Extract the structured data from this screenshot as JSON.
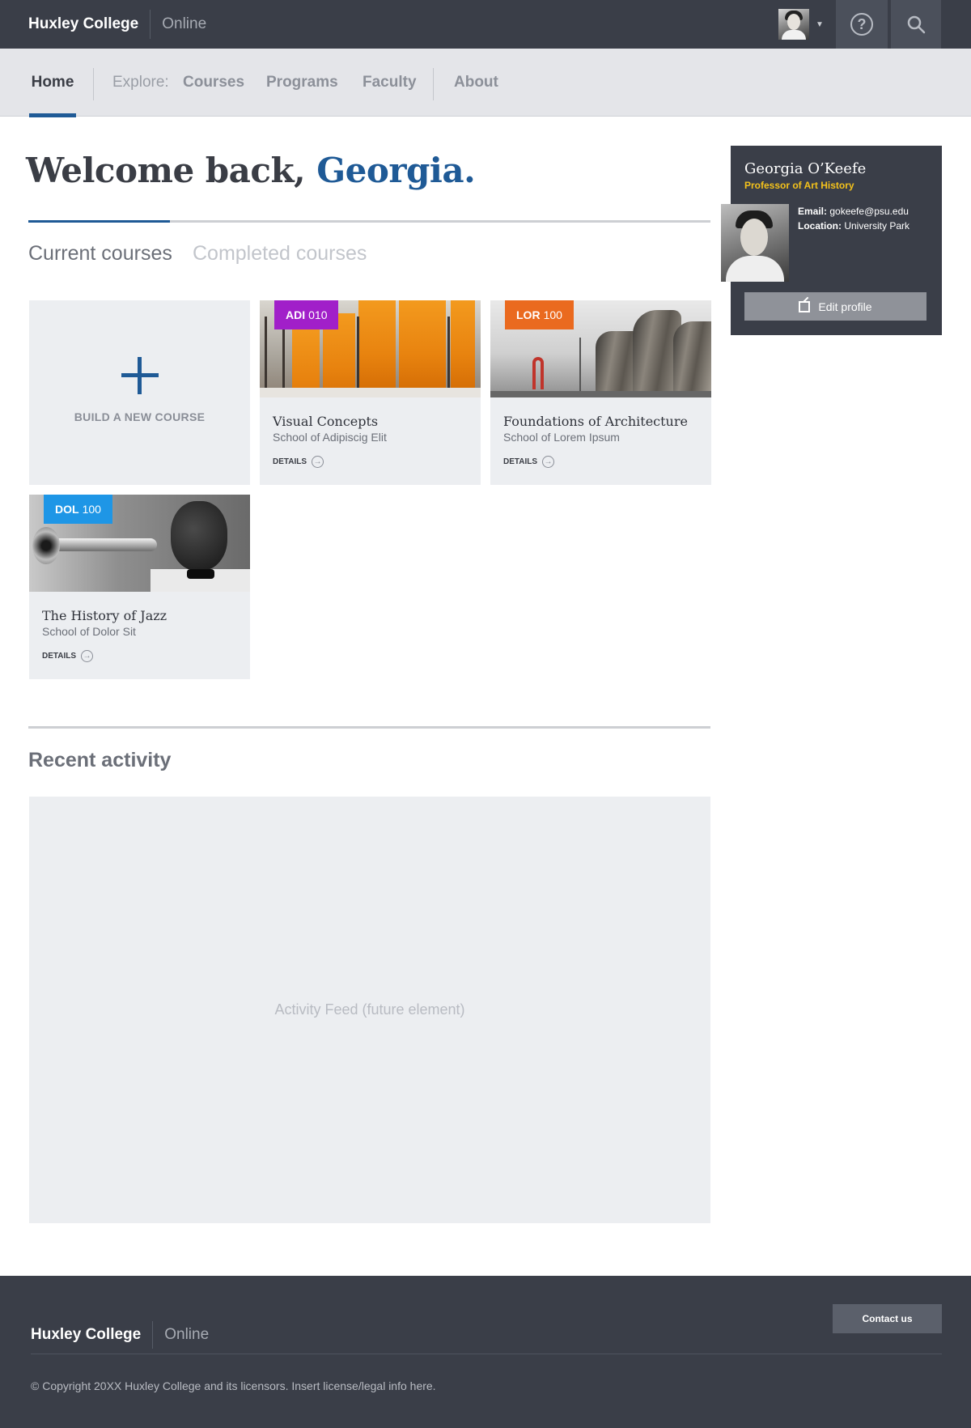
{
  "header": {
    "brand_name": "Huxley College",
    "brand_sub": "Online",
    "avatar_icon": "user-avatar",
    "help_icon": "help-icon",
    "search_icon": "search-icon"
  },
  "nav": {
    "home": "Home",
    "explore_label": "Explore:",
    "items": [
      "Courses",
      "Programs",
      "Faculty",
      "About"
    ]
  },
  "welcome": {
    "greeting": "Welcome back, ",
    "name": "Georgia."
  },
  "tabs": {
    "current": "Current courses",
    "completed": "Completed courses"
  },
  "build_card": {
    "label": "BUILD A NEW COURSE"
  },
  "courses": [
    {
      "code_prefix": "ADI",
      "code_num": "010",
      "badge_color": "#a11fc9",
      "title": "Visual Concepts",
      "school": "School of Adipiscig Elit",
      "details": "DETAILS"
    },
    {
      "code_prefix": "LOR",
      "code_num": "100",
      "badge_color": "#ea6a1f",
      "title": "Foundations of Architecture",
      "school": "School of Lorem Ipsum",
      "details": "DETAILS"
    },
    {
      "code_prefix": "DOL",
      "code_num": "100",
      "badge_color": "#1e96e6",
      "title": "The History of Jazz",
      "school": "School of Dolor Sit",
      "details": "DETAILS"
    }
  ],
  "activity": {
    "title": "Recent activity",
    "placeholder": "Activity Feed (future element)"
  },
  "profile": {
    "name": "Georgia O’Keefe",
    "role": "Professor of Art History",
    "email_label": "Email:",
    "email": "gokeefe@psu.edu",
    "location_label": "Location:",
    "location": "University Park",
    "edit_label": "Edit profile"
  },
  "footer": {
    "brand_name": "Huxley College",
    "brand_sub": "Online",
    "contact_label": "Contact us",
    "copyright": "© Copyright 20XX Huxley College and its licensors. Insert license/legal info here."
  },
  "colors": {
    "accent": "#1f5a96",
    "header_bg": "#3a3e48",
    "role_highlight": "#f4c21b"
  }
}
